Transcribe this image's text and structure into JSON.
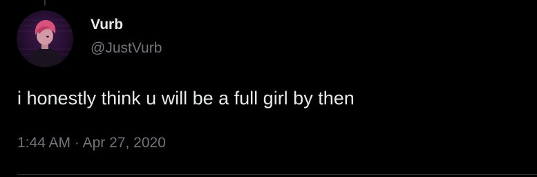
{
  "tweet": {
    "author": {
      "display_name": "Vurb",
      "handle": "@JustVurb",
      "avatar": "avatar-image"
    },
    "text": "i honestly think u will be a full girl by then",
    "time": "1:44 AM",
    "separator": "·",
    "date": "Apr 27, 2020"
  },
  "colors": {
    "background": "#000000",
    "primary_text": "#e7e9ea",
    "secondary_text": "#71767b",
    "divider": "#2f3336"
  }
}
